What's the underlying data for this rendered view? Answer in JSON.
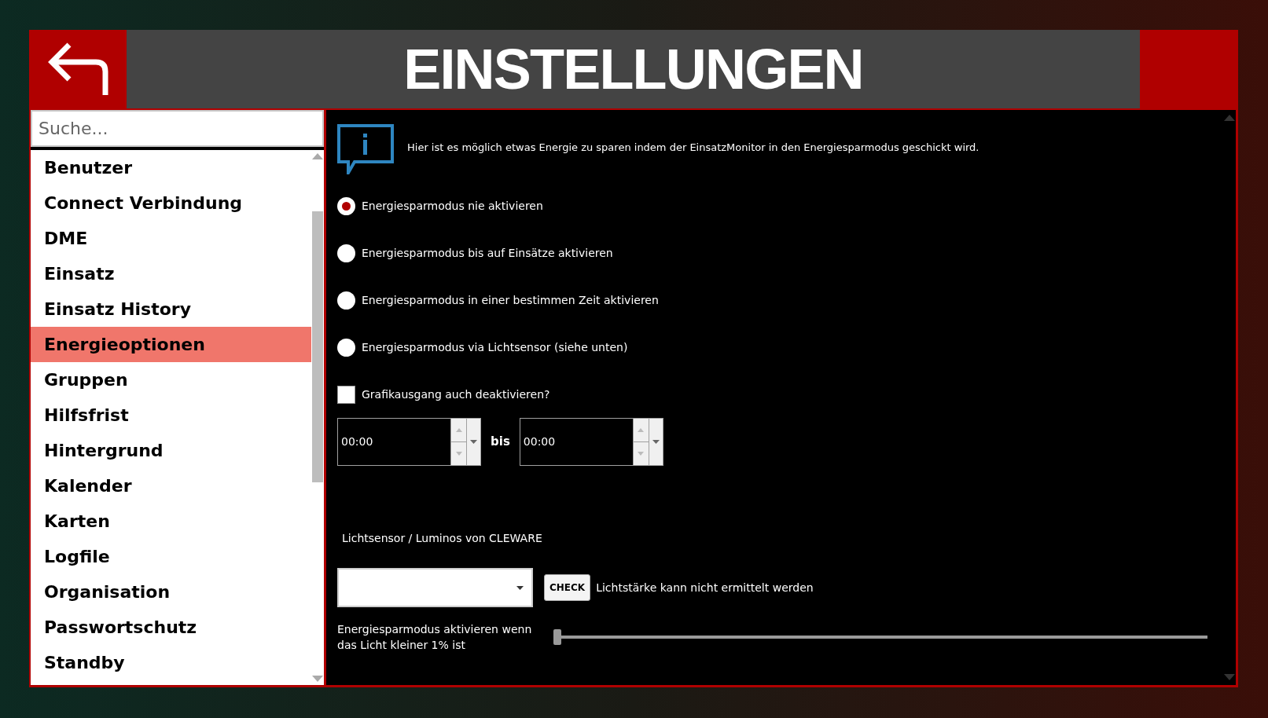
{
  "header": {
    "title": "EINSTELLUNGEN"
  },
  "search": {
    "placeholder": "Suche..."
  },
  "sidebar": {
    "items": [
      {
        "label": "Benutzer",
        "selected": false
      },
      {
        "label": "Connect Verbindung",
        "selected": false
      },
      {
        "label": "DME",
        "selected": false
      },
      {
        "label": "Einsatz",
        "selected": false
      },
      {
        "label": "Einsatz History",
        "selected": false
      },
      {
        "label": "Energieoptionen",
        "selected": true
      },
      {
        "label": "Gruppen",
        "selected": false
      },
      {
        "label": "Hilfsfrist",
        "selected": false
      },
      {
        "label": "Hintergrund",
        "selected": false
      },
      {
        "label": "Kalender",
        "selected": false
      },
      {
        "label": "Karten",
        "selected": false
      },
      {
        "label": "Logfile",
        "selected": false
      },
      {
        "label": "Organisation",
        "selected": false
      },
      {
        "label": "Passwortschutz",
        "selected": false
      },
      {
        "label": "Standby",
        "selected": false
      }
    ]
  },
  "info": "Hier ist es möglich etwas Energie zu sparen indem der EinsatzMonitor in den Energiesparmodus geschickt wird.",
  "modes": [
    {
      "label": "Energiesparmodus nie aktivieren",
      "selected": true
    },
    {
      "label": "Energiesparmodus bis auf Einsätze aktivieren",
      "selected": false
    },
    {
      "label": "Energiesparmodus in einer bestimmen Zeit aktivieren",
      "selected": false
    },
    {
      "label": "Energiesparmodus via Lichtsensor (siehe unten)",
      "selected": false
    }
  ],
  "graphics_checkbox": {
    "label": "Grafikausgang auch deaktivieren?",
    "checked": false
  },
  "time_from": {
    "value": "00:00"
  },
  "time_separator": "bis",
  "time_to": {
    "value": "00:00"
  },
  "sensor_label": "Lichtsensor / Luminos von CLEWARE",
  "check_button": "CHECK",
  "sensor_status": "Lichtstärke kann nicht ermittelt werden",
  "threshold": {
    "label": "Energiesparmodus aktivieren wenn das Licht kleiner 1% ist",
    "level": 0.0
  }
}
